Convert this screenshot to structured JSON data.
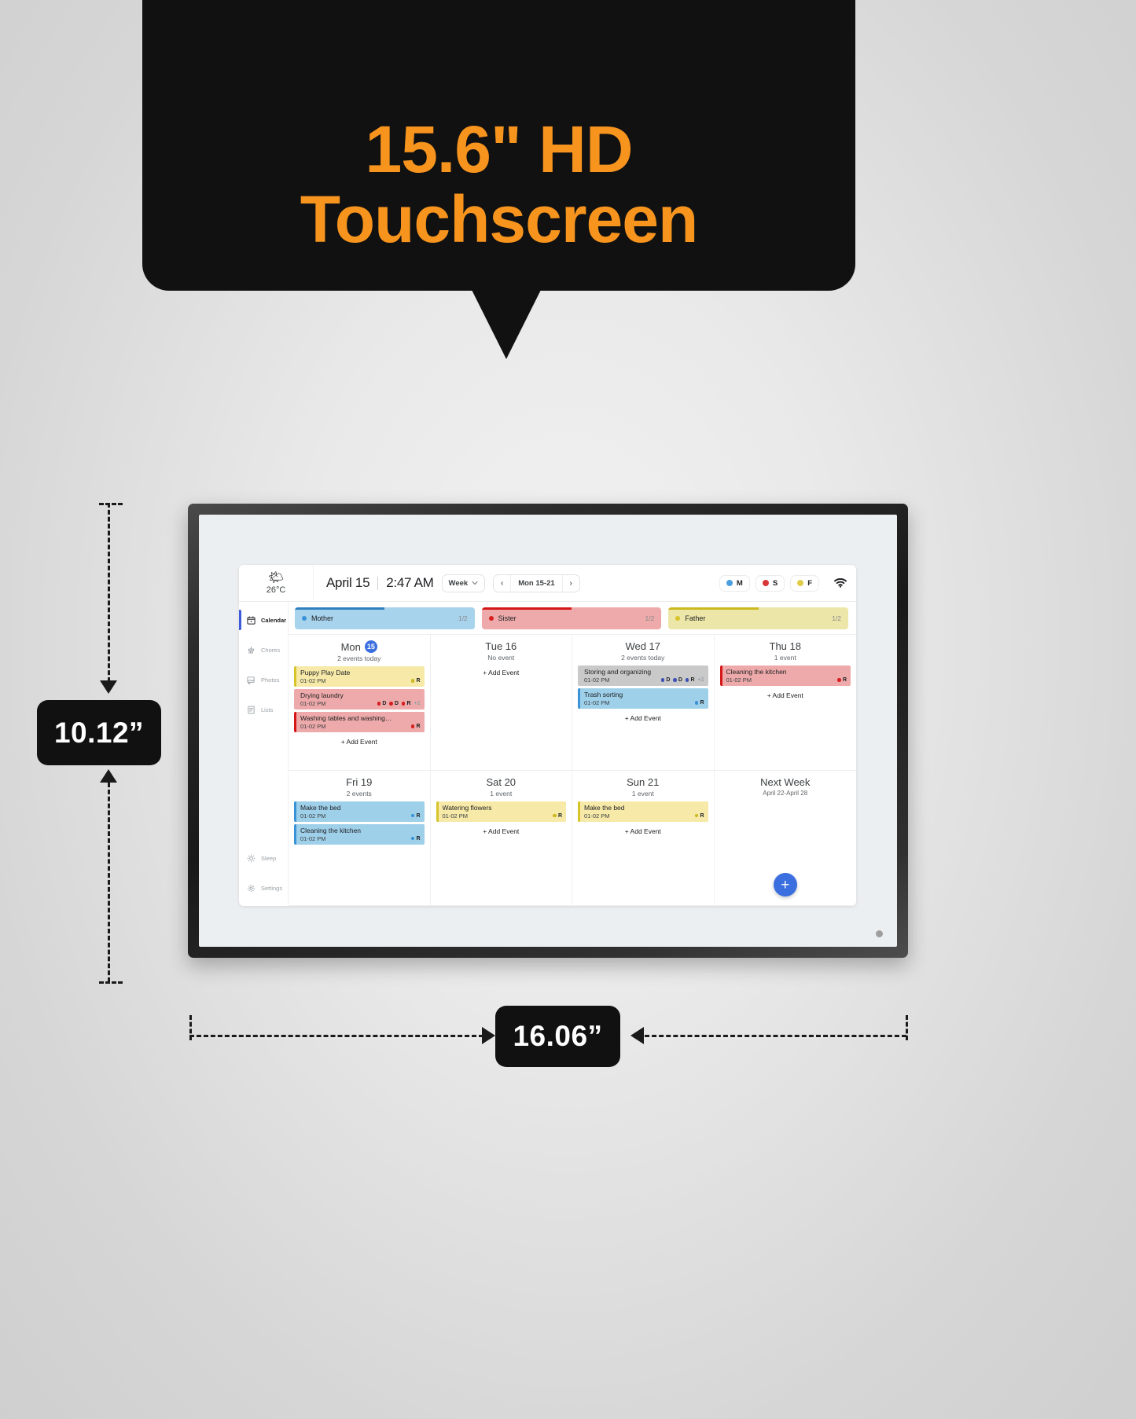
{
  "promo": {
    "line1": "15.6\" HD",
    "line2": "Touchscreen",
    "accent_color": "#f7941e",
    "bg_color": "#111111"
  },
  "dimensions": {
    "height_label": "10.12”",
    "width_label": "16.06”"
  },
  "app": {
    "weather": {
      "icon": "sun-cloud-icon",
      "temperature": "26°C"
    },
    "header": {
      "date": "April 15",
      "time": "2:47 AM",
      "view_selector": "Week",
      "range_prev": "‹",
      "range_label": "Mon 15-21",
      "range_next": "›",
      "wifi_icon": "wifi-icon"
    },
    "member_chips": [
      {
        "initial": "M",
        "color": "#4a9fe0"
      },
      {
        "initial": "S",
        "color": "#d93636"
      },
      {
        "initial": "F",
        "color": "#e0cc4a"
      }
    ],
    "sidebar": [
      {
        "label": "Calendar",
        "icon": "calendar-icon",
        "active": true
      },
      {
        "label": "Chores",
        "icon": "broom-icon",
        "active": false
      },
      {
        "label": "Photos",
        "icon": "photo-add-icon",
        "active": false
      },
      {
        "label": "Lists",
        "icon": "list-icon",
        "active": false
      },
      {
        "label": "Sleep",
        "icon": "sun-icon",
        "active": false
      },
      {
        "label": "Settings",
        "icon": "gear-icon",
        "active": false
      }
    ],
    "progress": [
      {
        "name": "Mother",
        "count": "1/2",
        "dot": "#3a93d6",
        "bg": "#a8d3ec",
        "bar": "#2f7fbf",
        "fill_pct": 50
      },
      {
        "name": "Sister",
        "count": "1/2",
        "dot": "#d62020",
        "bg": "#eeaaaa",
        "bar": "#d41717",
        "fill_pct": 50
      },
      {
        "name": "Father",
        "count": "1/2",
        "dot": "#d6c42a",
        "bg": "#ece6a8",
        "bar": "#cbb91f",
        "fill_pct": 50
      }
    ],
    "days": [
      {
        "title": "Mon",
        "badge": "15",
        "subtitle": "2 events today",
        "events": [
          {
            "title": "Puppy Play Date",
            "time": "01-02 PM",
            "bg": "#f7eaa8",
            "accent": "#d6c42a",
            "tags": [
              {
                "label": "R",
                "color": "#cbb91f"
              }
            ],
            "more": ""
          },
          {
            "title": "Drying laundry",
            "time": "01-02 PM",
            "bg": "#eeaaaa",
            "accent": "#eeaaaa",
            "tags": [
              {
                "label": "D",
                "color": "#d62020"
              },
              {
                "label": "D",
                "color": "#d62020"
              },
              {
                "label": "R",
                "color": "#d62020"
              }
            ],
            "more": "+2"
          },
          {
            "title": "Washing tables and washing…",
            "time": "01-02 PM",
            "bg": "#eeaaaa",
            "accent": "#d41717",
            "tags": [
              {
                "label": "R",
                "color": "#d62020"
              }
            ],
            "more": ""
          }
        ],
        "add_label": "+ Add Event"
      },
      {
        "title": "Tue 16",
        "badge": "",
        "subtitle": "No event",
        "events": [],
        "add_label": "+ Add Event"
      },
      {
        "title": "Wed 17",
        "badge": "",
        "subtitle": "2 events today",
        "events": [
          {
            "title": "Storing and organizing",
            "time": "01-02 PM",
            "bg": "#c9c9c9",
            "accent": "#c9c9c9",
            "tags": [
              {
                "label": "D",
                "color": "#3f51b5"
              },
              {
                "label": "D",
                "color": "#3f51b5"
              },
              {
                "label": "R",
                "color": "#3f51b5"
              }
            ],
            "more": "+2"
          },
          {
            "title": "Trash sorting",
            "time": "01-02 PM",
            "bg": "#9fd0ea",
            "accent": "#3a93d6",
            "tags": [
              {
                "label": "R",
                "color": "#3a93d6"
              }
            ],
            "more": ""
          }
        ],
        "add_label": "+ Add Event"
      },
      {
        "title": "Thu 18",
        "badge": "",
        "subtitle": "1 event",
        "events": [
          {
            "title": "Cleaning the kitchen",
            "time": "01-02 PM",
            "bg": "#eeaaaa",
            "accent": "#d41717",
            "tags": [
              {
                "label": "R",
                "color": "#d62020"
              }
            ],
            "more": ""
          }
        ],
        "add_label": "+ Add Event"
      },
      {
        "title": "Fri 19",
        "badge": "",
        "subtitle": "2 events",
        "events": [
          {
            "title": "Make the bed",
            "time": "01-02 PM",
            "bg": "#9fd0ea",
            "accent": "#3a93d6",
            "tags": [
              {
                "label": "R",
                "color": "#3a93d6"
              }
            ],
            "more": ""
          },
          {
            "title": "Cleaning the kitchen",
            "time": "01-02 PM",
            "bg": "#9fd0ea",
            "accent": "#3a93d6",
            "tags": [
              {
                "label": "R",
                "color": "#3a93d6"
              }
            ],
            "more": ""
          }
        ],
        "add_label": ""
      },
      {
        "title": "Sat 20",
        "badge": "",
        "subtitle": "1 event",
        "events": [
          {
            "title": "Watering flowers",
            "time": "01-02 PM",
            "bg": "#f7eaa8",
            "accent": "#d6c42a",
            "tags": [
              {
                "label": "R",
                "color": "#cbb91f"
              }
            ],
            "more": ""
          }
        ],
        "add_label": "+ Add Event"
      },
      {
        "title": "Sun 21",
        "badge": "",
        "subtitle": "1 event",
        "events": [
          {
            "title": "Make the bed",
            "time": "01-02 PM",
            "bg": "#f7eaa8",
            "accent": "#d6c42a",
            "tags": [
              {
                "label": "R",
                "color": "#cbb91f"
              }
            ],
            "more": ""
          }
        ],
        "add_label": "+ Add Event"
      }
    ],
    "next_week": {
      "title": "Next Week",
      "subtitle": "April 22-April 28",
      "fab_label": "+"
    }
  }
}
